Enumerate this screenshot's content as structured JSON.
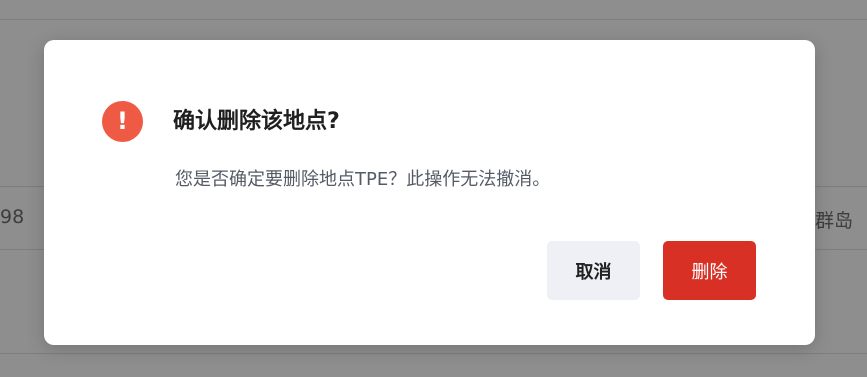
{
  "background": {
    "left_cell": "98",
    "right_cell": "群岛"
  },
  "dialog": {
    "icon": "exclamation-circle-icon",
    "icon_glyph": "!",
    "title": "确认删除该地点?",
    "message": "您是否确定要删除地点TPE？此操作无法撤消。",
    "cancel_label": "取消",
    "delete_label": "删除"
  },
  "colors": {
    "danger": "#d93025",
    "warning_icon": "#ef5a45",
    "cancel_bg": "#eef0f6",
    "overlay": "#8e8e8e"
  }
}
